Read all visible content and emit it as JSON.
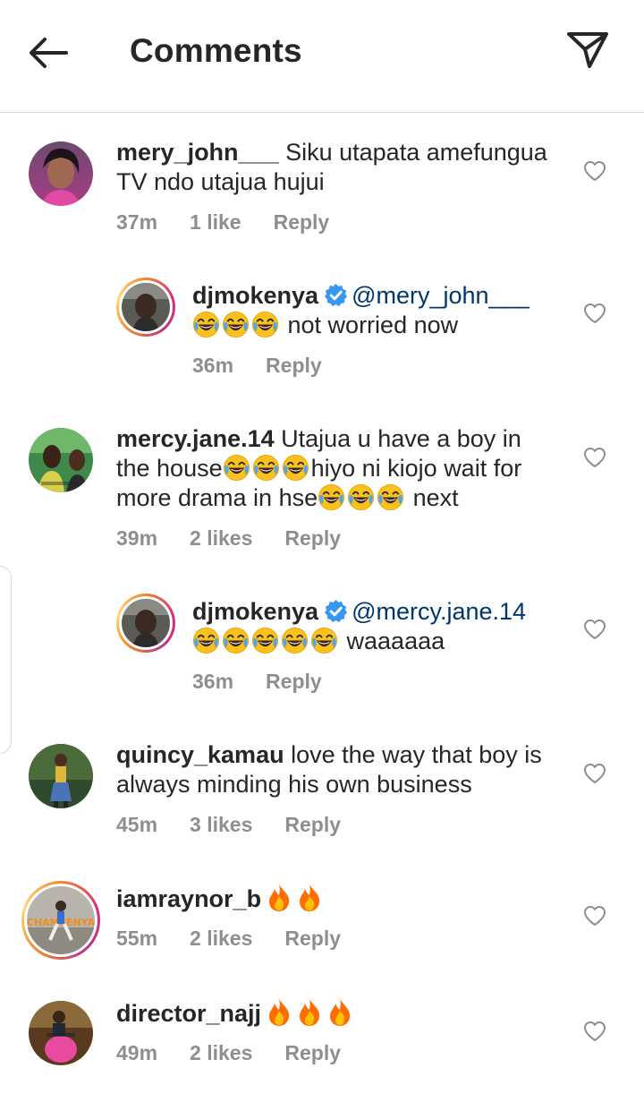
{
  "header": {
    "title": "Comments",
    "back_icon": "arrow-left-icon",
    "send_icon": "paper-plane-icon"
  },
  "colors": {
    "text": "#262626",
    "muted": "#8e8e8e",
    "mention": "#00376b",
    "verified": "#3897f0",
    "divider": "#dbdbdb"
  },
  "comments": [
    {
      "username": "mery_john___",
      "text": "Siku utapata amefungua TV ndo utajua hujui",
      "time": "37m",
      "likes": "1 like",
      "reply": "Reply"
    },
    {
      "username": "djmokenya",
      "verified": true,
      "mention": "@mery_john___",
      "emoji": "😂😂😂",
      "text": "not worried now",
      "time": "36m",
      "reply": "Reply"
    },
    {
      "username": "mercy.jane.14",
      "text_a": "Utajua u have a boy in the house",
      "emoji_a": "😂😂😂",
      "text_b": "hiyo ni kiojo wait for more drama in hse",
      "emoji_b": "😂😂😂",
      "text_c": "next",
      "time": "39m",
      "likes": "2 likes",
      "reply": "Reply"
    },
    {
      "username": "djmokenya",
      "verified": true,
      "mention": "@mercy.jane.14",
      "emoji": "😂😂😂😂😂",
      "text": "waaaaaa",
      "time": "36m",
      "reply": "Reply"
    },
    {
      "username": "quincy_kamau",
      "text": "love the way that boy is always minding his own business",
      "time": "45m",
      "likes": "3 likes",
      "reply": "Reply"
    },
    {
      "username": "iamraynor_b",
      "emoji": "🔥🔥",
      "time": "55m",
      "likes": "2 likes",
      "reply": "Reply",
      "avatar_text": "CHANGENYA"
    },
    {
      "username": "director_najj",
      "emoji": "🔥🔥🔥",
      "time": "49m",
      "likes": "2 likes",
      "reply": "Reply"
    }
  ],
  "icons": {
    "heart": "heart-outline-icon",
    "verified": "verified-badge-icon",
    "laugh": "tears-of-joy-emoji-icon",
    "fire": "fire-emoji-icon"
  }
}
